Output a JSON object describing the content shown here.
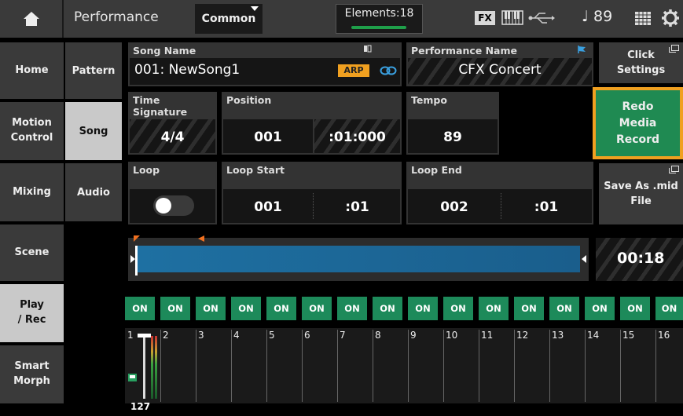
{
  "topbar": {
    "title": "Performance",
    "common_label": "Common",
    "elements_label": "Elements:18",
    "fx_label": "FX",
    "tempo_display": "♩ 89"
  },
  "sidebar": {
    "items": [
      {
        "label": "Home"
      },
      {
        "label": "Motion\nControl"
      },
      {
        "label": "Mixing"
      },
      {
        "label": "Scene"
      },
      {
        "label": "Play\n/ Rec"
      },
      {
        "label": "Smart\nMorph"
      }
    ]
  },
  "subnav": {
    "items": [
      {
        "label": "Pattern"
      },
      {
        "label": "Song"
      },
      {
        "label": "Audio"
      }
    ]
  },
  "song": {
    "song_name_label": "Song Name",
    "song_name_value": "001: NewSong1",
    "arp_badge": "ARP",
    "performance_name_label": "Performance Name",
    "performance_name_value": "CFX Concert",
    "time_signature_label": "Time Signature",
    "time_signature_value": "4/4",
    "position_label": "Position",
    "position_measure": "001",
    "position_beat": ":01:000",
    "tempo_label": "Tempo",
    "tempo_value": "89",
    "loop_label": "Loop",
    "loop_start_label": "Loop Start",
    "loop_start_measure": "001",
    "loop_start_beat": ":01",
    "loop_end_label": "Loop End",
    "loop_end_measure": "002",
    "loop_end_beat": ":01",
    "time_display": "00:18"
  },
  "right_buttons": {
    "click_settings": "Click\nSettings",
    "redo_media_record": "Redo\nMedia\nRecord",
    "save_as_mid": "Save As .mid\nFile"
  },
  "tracks": {
    "on_label": "ON",
    "numbers": [
      "1",
      "2",
      "3",
      "4",
      "5",
      "6",
      "7",
      "8",
      "9",
      "10",
      "11",
      "12",
      "13",
      "14",
      "15",
      "16"
    ],
    "track1_volume": "127"
  },
  "colors": {
    "accent_green": "#1d8a5a",
    "redo_bg": "#1f8a52",
    "redo_border": "#f0a020",
    "arp_badge": "#f0a020",
    "progress_bar": "#1a6c9a"
  }
}
